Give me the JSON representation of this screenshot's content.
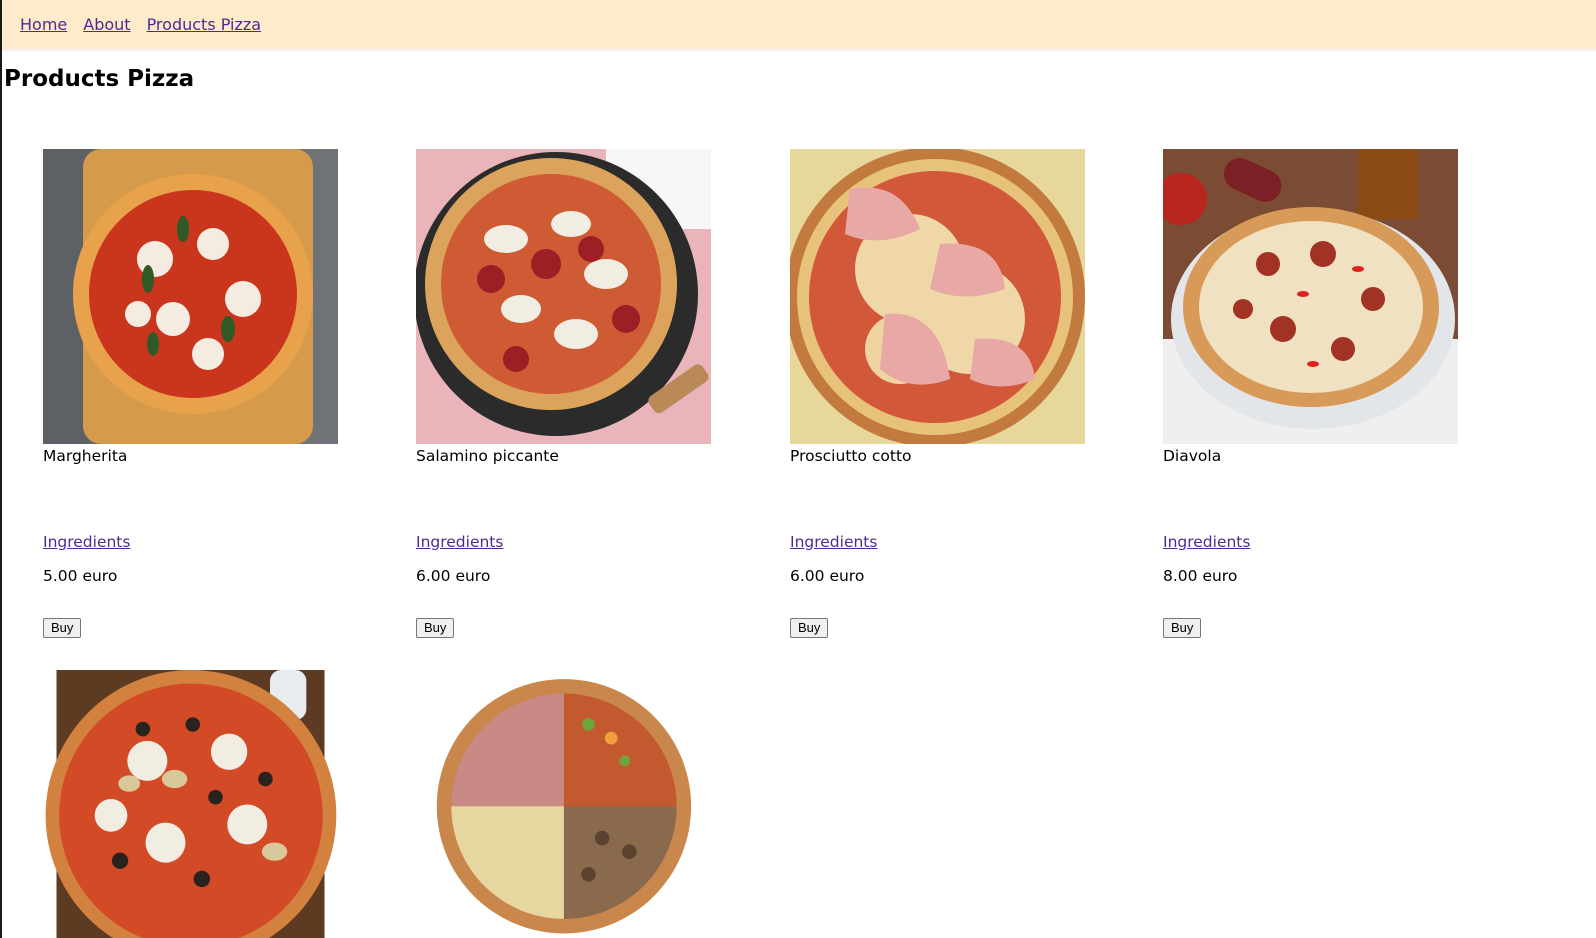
{
  "nav": {
    "links": [
      {
        "label": "Home"
      },
      {
        "label": "About"
      },
      {
        "label": "Products Pizza"
      }
    ],
    "link_color": "#4f2a90",
    "background": "#fdebc9"
  },
  "page_title": "Products Pizza",
  "products": [
    {
      "name": "Margherita",
      "ingredients_label": "Ingredients",
      "price": "5.00 euro",
      "buy_label": "Buy"
    },
    {
      "name": "Salamino piccante",
      "ingredients_label": "Ingredients",
      "price": "6.00 euro",
      "buy_label": "Buy"
    },
    {
      "name": "Prosciutto cotto",
      "ingredients_label": "Ingredients",
      "price": "6.00 euro",
      "buy_label": "Buy"
    },
    {
      "name": "Diavola",
      "ingredients_label": "Ingredients",
      "price": "8.00 euro",
      "buy_label": "Buy"
    },
    {
      "name": "",
      "ingredients_label": "",
      "price": "",
      "buy_label": ""
    },
    {
      "name": "",
      "ingredients_label": "",
      "price": "",
      "buy_label": ""
    }
  ]
}
